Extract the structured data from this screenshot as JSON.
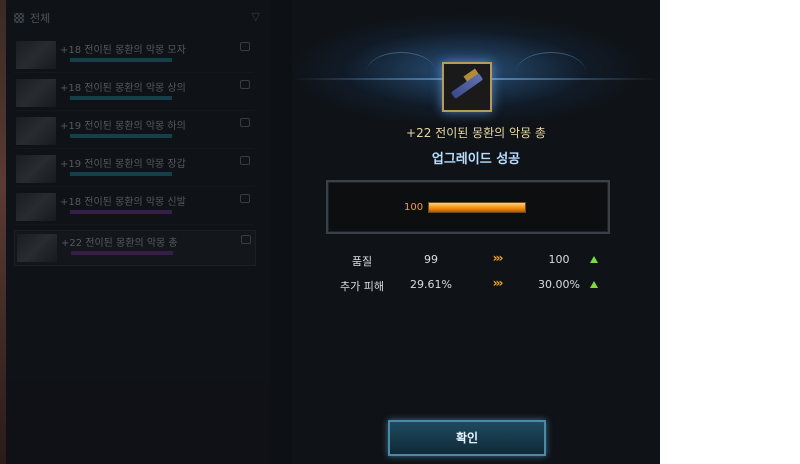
{
  "list": {
    "header": "전체",
    "items": [
      {
        "name": "+18 전이된 몽환의 악몽 모자",
        "bar": "teal"
      },
      {
        "name": "+18 전이된 몽환의 악몽 상의",
        "bar": "teal"
      },
      {
        "name": "+19 전이된 몽환의 악몽 하의",
        "bar": "teal"
      },
      {
        "name": "+19 전이된 몽환의 악몽 장갑",
        "bar": "teal"
      },
      {
        "name": "+18 전이된 몽환의 악몽 신발",
        "bar": "purple"
      },
      {
        "name": "+22 전이된 몽환의 악몽 총",
        "bar": "purple"
      }
    ]
  },
  "result": {
    "item_name": "+22 전이된 몽환의 악몽 총",
    "status": "업그레이드 성공",
    "gauge_value": "100",
    "gauge_fill_fraction": 1.0
  },
  "stats": [
    {
      "label": "품질",
      "before": "99",
      "after": "100"
    },
    {
      "label": "추가 피해",
      "before": "29.61%",
      "after": "30.00%"
    }
  ],
  "arrows_glyph": "›››",
  "confirm_label": "확인",
  "colors": {
    "gauge": "#f08a10",
    "up_arrow": "#7cdc3a",
    "status_text": "#b9ddff",
    "item_name_text": "#e8d6a8"
  }
}
